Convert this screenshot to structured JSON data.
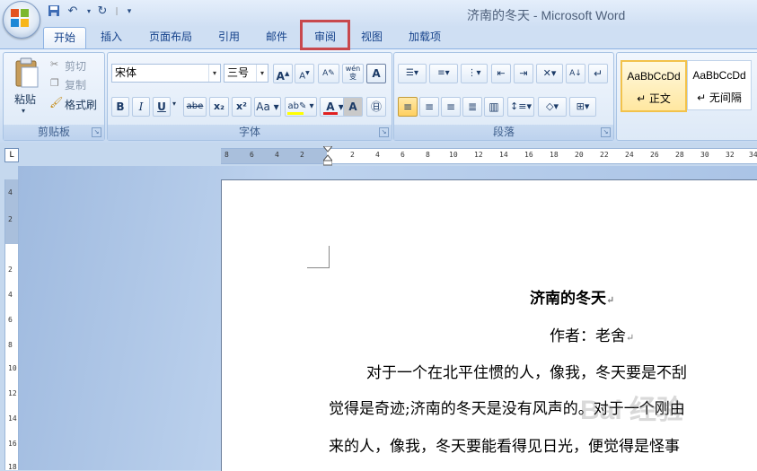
{
  "window": {
    "title": "济南的冬天 - Microsoft Word"
  },
  "quick_access": {
    "save_icon": "save-icon",
    "undo_icon": "undo-icon",
    "redo_icon": "redo-icon",
    "customize_icon": "customize-qat-icon"
  },
  "tabs": [
    {
      "label": "开始",
      "active": true
    },
    {
      "label": "插入"
    },
    {
      "label": "页面布局"
    },
    {
      "label": "引用"
    },
    {
      "label": "邮件"
    },
    {
      "label": "审阅",
      "highlighted": true
    },
    {
      "label": "视图"
    },
    {
      "label": "加载项"
    }
  ],
  "clipboard": {
    "label": "剪贴板",
    "paste": "粘贴",
    "cut": "剪切",
    "copy": "复制",
    "format_painter": "格式刷"
  },
  "font": {
    "label": "字体",
    "name": "宋体",
    "size": "三号",
    "bold": "B",
    "italic": "I",
    "underline": "U",
    "strike": "abe",
    "subscript": "x₂",
    "superscript": "x²",
    "change_case": "Aa",
    "grow": "A",
    "shrink": "A",
    "phonetic": "wén",
    "highlight_color": "#ffff00",
    "font_color": "#e02020"
  },
  "paragraph": {
    "label": "段落"
  },
  "styles": [
    {
      "sample": "AaBbCcDd",
      "name": "↵ 正文",
      "selected": true
    },
    {
      "sample": "AaBbCcDd",
      "name": "↵ 无间隔"
    }
  ],
  "ruler": {
    "h_ticks": [
      "8",
      "6",
      "4",
      "2",
      "2",
      "4",
      "6",
      "8",
      "10",
      "12",
      "14",
      "16",
      "18",
      "20",
      "22",
      "24",
      "26",
      "28",
      "30",
      "32",
      "34"
    ],
    "v_ticks": [
      "4",
      "2",
      "2",
      "4",
      "6",
      "8",
      "10",
      "12",
      "14",
      "16",
      "18"
    ]
  },
  "document": {
    "title": "济南的冬天",
    "author": "作者：老舍",
    "lines": [
      "对于一个在北平住惯的人，像我，冬天要是不刮",
      "觉得是奇迹;济南的冬天是没有风声的。对于一个刚由",
      "来的人，像我，冬天要能看得见日光，便觉得是怪事"
    ],
    "return_mark": "↵"
  },
  "watermark": "Bai 经验"
}
